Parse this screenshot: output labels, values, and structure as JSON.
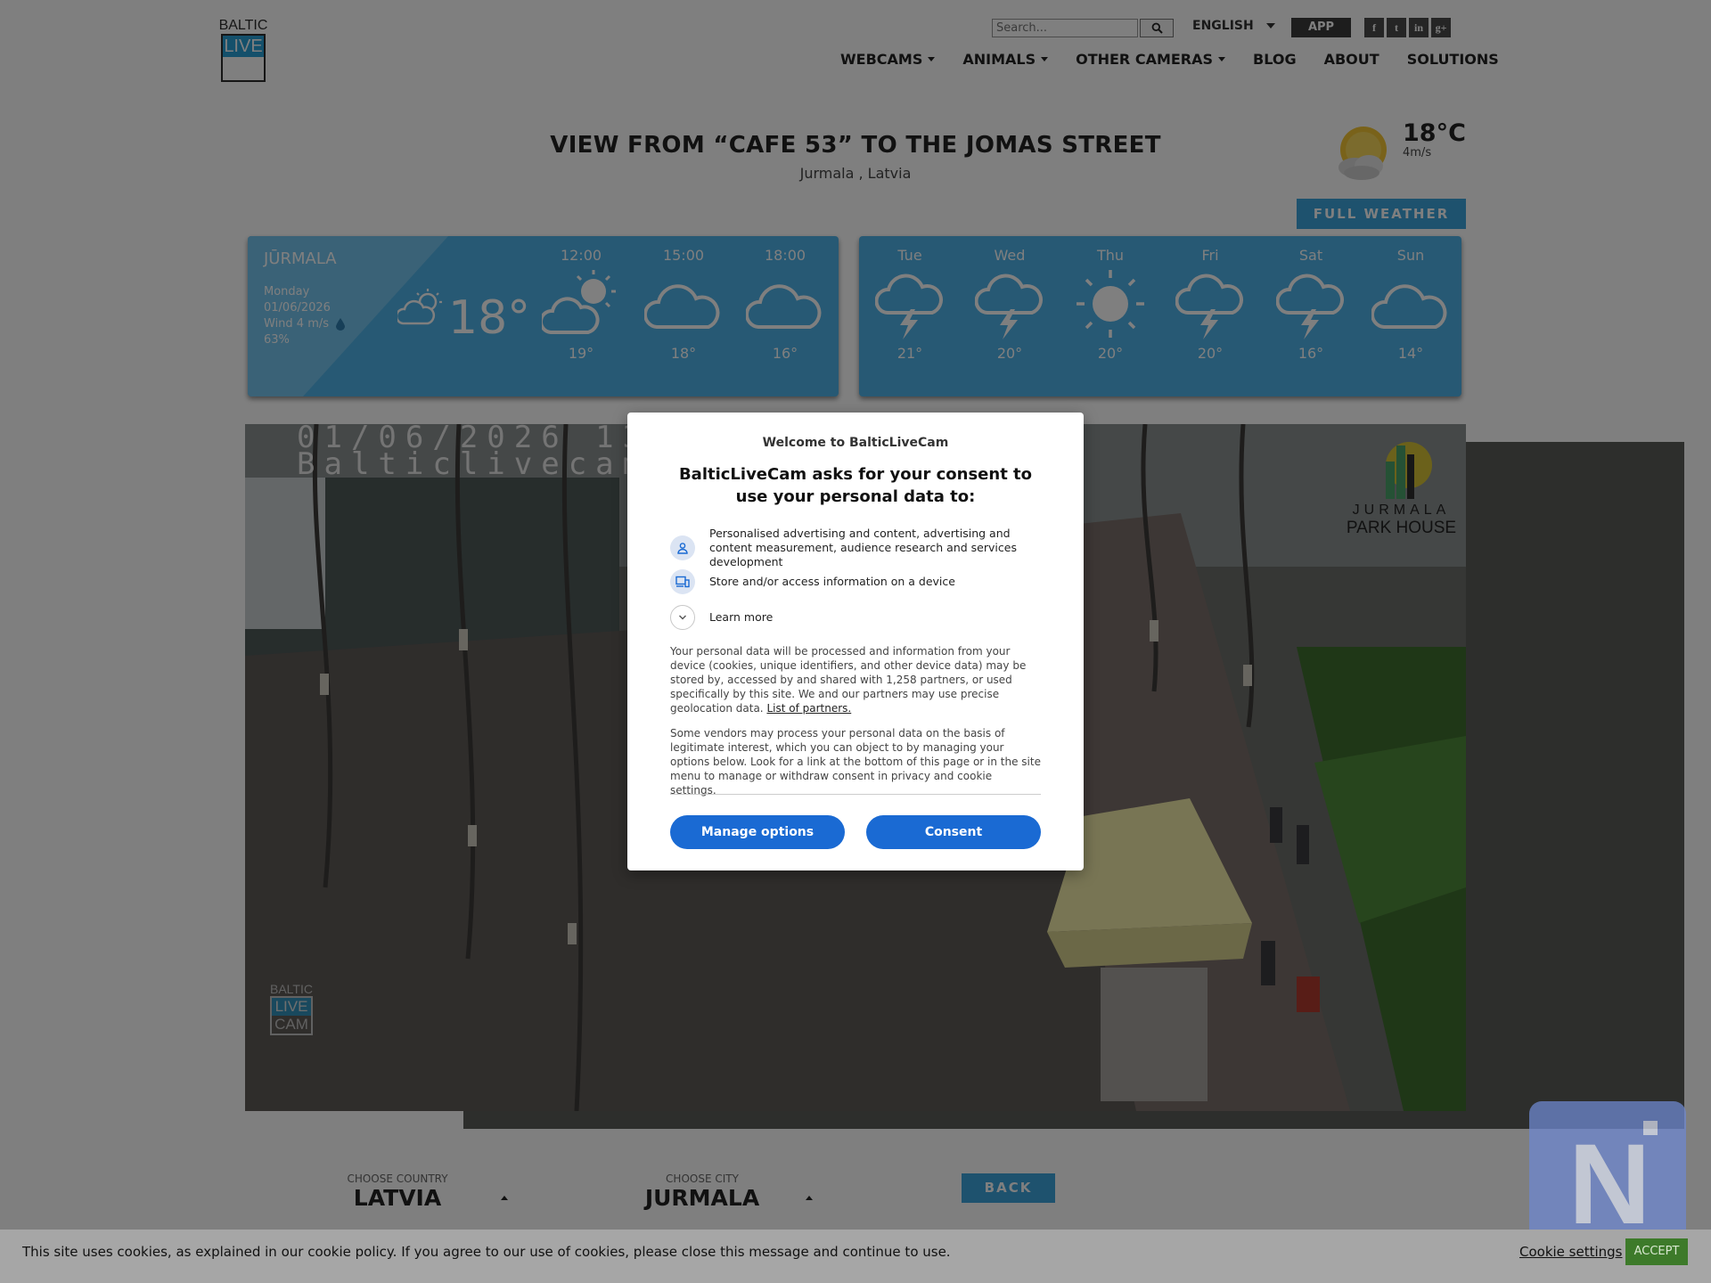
{
  "logo": {
    "line1": "BALTIC",
    "line2": "LIVE",
    "line3": "CAM"
  },
  "header": {
    "search_placeholder": "Search...",
    "language": "ENGLISH",
    "app_label": "APP",
    "socials": [
      "f",
      "t",
      "in",
      "g+"
    ]
  },
  "nav": {
    "items": [
      {
        "label": "WEBCAMS",
        "dropdown": true
      },
      {
        "label": "ANIMALS",
        "dropdown": true
      },
      {
        "label": "OTHER CAMERAS",
        "dropdown": true
      },
      {
        "label": "BLOG",
        "dropdown": false
      },
      {
        "label": "ABOUT",
        "dropdown": false
      },
      {
        "label": "SOLUTIONS",
        "dropdown": false
      }
    ]
  },
  "page": {
    "title": "VIEW FROM “CAFE 53” TO THE JOMAS STREET",
    "subtitle": "Jurmala , Latvia"
  },
  "current_weather": {
    "temp": "18°C",
    "wind": "4m/s",
    "icon": "sun-cloud-icon",
    "full_weather_label": "FULL WEATHER"
  },
  "today": {
    "city": "JŪRMALA",
    "day": "Monday",
    "date": "01/06/2026",
    "wind": "Wind 4 m/s",
    "humidity": "63%",
    "temp": "18°",
    "icon": "partly-cloudy-icon",
    "hours": [
      {
        "time": "12:00",
        "temp": "19°",
        "icon": "sun-cloud-icon"
      },
      {
        "time": "15:00",
        "temp": "18°",
        "icon": "cloud-icon"
      },
      {
        "time": "18:00",
        "temp": "16°",
        "icon": "cloud-icon"
      }
    ]
  },
  "week": [
    {
      "day": "Tue",
      "temp": "21°",
      "icon": "thunderstorm-icon"
    },
    {
      "day": "Wed",
      "temp": "20°",
      "icon": "thunderstorm-icon"
    },
    {
      "day": "Thu",
      "temp": "20°",
      "icon": "sun-icon"
    },
    {
      "day": "Fri",
      "temp": "20°",
      "icon": "thunderstorm-icon"
    },
    {
      "day": "Sat",
      "temp": "16°",
      "icon": "thunderstorm-icon"
    },
    {
      "day": "Sun",
      "temp": "14°",
      "icon": "cloud-icon"
    }
  ],
  "webcam": {
    "timestamp_line1": "01/06/2026 13",
    "timestamp_line2": "Balticlivecam",
    "watermark": {
      "line1": "BALTIC",
      "line2": "LIVE",
      "line3": "CAM"
    },
    "brand": {
      "line1": "JURMALA",
      "line2": "PARK HOUSE"
    }
  },
  "selectors": {
    "country_caption": "CHOOSE COUNTRY",
    "country_value": "LATVIA",
    "city_caption": "CHOOSE CITY",
    "city_value": "JURMALA",
    "back_label": "BACK"
  },
  "consent": {
    "welcome": "Welcome to BalticLiveCam",
    "heading": "BalticLiveCam asks for your consent to use your personal data to:",
    "purposes": [
      {
        "icon": "person-icon",
        "text": "Personalised advertising and content, advertising and content measurement, audience research and services development"
      },
      {
        "icon": "device-icon",
        "text": "Store and/or access information on a device"
      }
    ],
    "learn_more": "Learn more",
    "paragraph1": "Your personal data will be processed and information from your device (cookies, unique identifiers, and other device data) may be stored by, accessed by and shared with 1,258 partners, or used specifically by this site. We and our partners may use precise geolocation data.",
    "partners_link": "List of partners.",
    "paragraph2": "Some vendors may process your personal data on the basis of legitimate interest, which you can object to by managing your options below. Look for a link at the bottom of this page or in the site menu to manage or withdraw consent in privacy and cookie settings.",
    "manage_label": "Manage options",
    "consent_label": "Consent"
  },
  "cookie_bar": {
    "text": "This site uses cookies, as explained in our cookie policy. If you agree to our use of cookies, please close this message and continue to use.",
    "settings_label": "Cookie settings",
    "accept_label": "ACCEPT"
  },
  "colors": {
    "accent_blue": "#3da5dc",
    "card_blue": "#4fb3e8",
    "consent_button": "#1a6ad3",
    "accept_green": "#3d7a2a"
  }
}
